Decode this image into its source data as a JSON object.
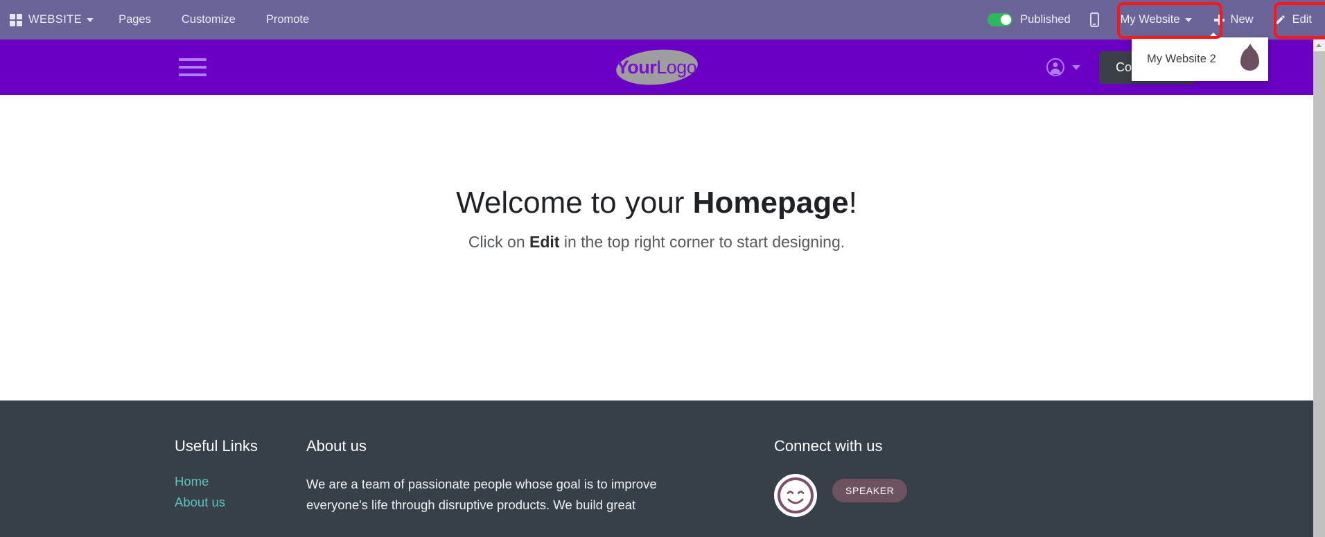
{
  "backend_bar": {
    "brand": {
      "label": "WEBSITE",
      "icon": "grid-icon"
    },
    "menu": [
      {
        "label": "Pages"
      },
      {
        "label": "Customize"
      },
      {
        "label": "Promote"
      }
    ],
    "publish_toggle": {
      "label": "Published",
      "state": "on",
      "color": "#2eb85c"
    },
    "mobile_preview": {
      "icon": "mobile-phone-icon"
    },
    "site_selector": {
      "label": "My Website",
      "highlighted": true,
      "highlight_color": "#f61919"
    },
    "new_button": {
      "label": "New",
      "icon": "plus-icon"
    },
    "edit_button": {
      "label": "Edit",
      "icon": "pencil-icon",
      "highlighted": true,
      "highlight_color": "#f61919"
    },
    "background_color": "#6b6498"
  },
  "site_dropdown": {
    "open": true,
    "items": [
      {
        "label": "My Website 2",
        "icon": "droplet-icon",
        "icon_color": "#6d4f62"
      }
    ]
  },
  "site_header": {
    "background_color": "#6900c4",
    "menu_icon": "hamburger-icon",
    "logo": {
      "bold_part": "Your",
      "light_part": "Logo"
    },
    "account_icon": "user-account-icon",
    "contact_button": {
      "label": "Contact Us"
    }
  },
  "main": {
    "title_plain": "Welcome to your ",
    "title_bold": "Homepage",
    "title_suffix": "!",
    "subtitle_before": "Click on ",
    "subtitle_bold": "Edit",
    "subtitle_after": " in the top right corner to start designing."
  },
  "footer": {
    "background_color": "#373f48",
    "useful_links": {
      "heading": "Useful Links",
      "links": [
        {
          "label": "Home"
        },
        {
          "label": "About us"
        }
      ],
      "link_color": "#56c5c0"
    },
    "about": {
      "heading": "About us",
      "text": "We are a team of passionate people whose goal is to improve everyone's life through disruptive products. We build great"
    },
    "connect": {
      "heading": "Connect with us",
      "avatar_icon": "smiley-face-icon",
      "badge": {
        "label": "SPEAKER"
      }
    }
  },
  "scrollbar": {
    "arrow_up_icon": "chevron-up-icon",
    "position": "top"
  }
}
